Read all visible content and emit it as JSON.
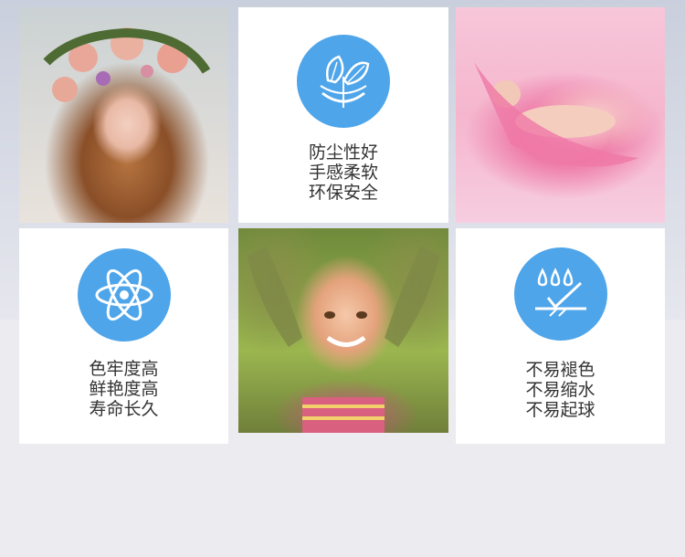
{
  "features": {
    "dust": {
      "icon": "leaf-globe-icon",
      "lines": [
        "防尘性好",
        "手感柔软",
        "环保安全"
      ]
    },
    "color": {
      "icon": "atom-icon",
      "lines": [
        "色牢度高",
        "鲜艳度高",
        "寿命长久"
      ]
    },
    "water": {
      "icon": "water-drops-icon",
      "lines": [
        "不易褪色",
        "不易缩水",
        "不易起球"
      ]
    }
  },
  "photos": [
    "woman-flower-crown-photo",
    "baby-on-petal-photo",
    "child-smiling-photo"
  ],
  "colors": {
    "accent": "#4ea5ea",
    "tile": "#ffffff",
    "text": "#333333"
  }
}
